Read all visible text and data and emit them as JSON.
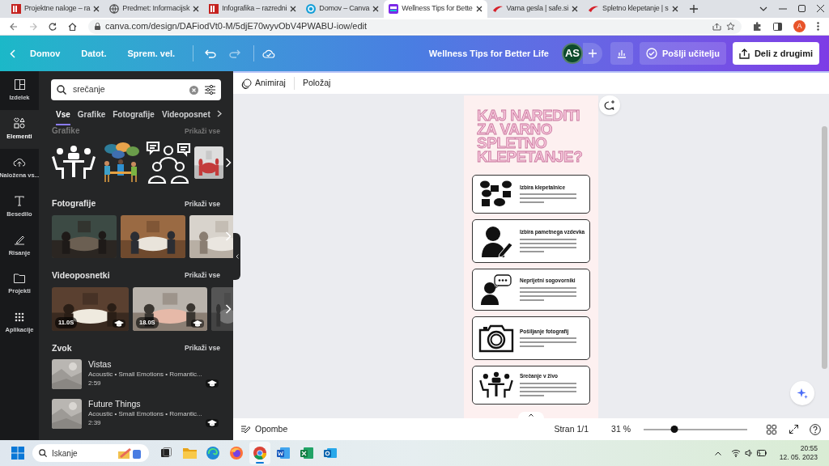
{
  "browser": {
    "tabs": [
      {
        "title": "Projektne naloge – ra",
        "kind": "slides",
        "selected": false
      },
      {
        "title": "Predmet: Informacijsk",
        "kind": "globe",
        "selected": false
      },
      {
        "title": "Infografika – razredni",
        "kind": "slides",
        "selected": false
      },
      {
        "title": "Domov – Canva",
        "kind": "canva",
        "selected": false
      },
      {
        "title": "Wellness Tips for Bette",
        "kind": "design",
        "selected": true
      },
      {
        "title": "Varna gesla | safe.si",
        "kind": "safe",
        "selected": false
      },
      {
        "title": "Spletno klepetanje | s",
        "kind": "safe",
        "selected": false
      }
    ],
    "url": "canva.com/design/DAFiodVt0-M/5djE70wyvObV4PWABU-iow/edit",
    "profile": "A"
  },
  "editor_bar": {
    "menu": [
      "Domov",
      "Datot.",
      "Sprem. vel."
    ],
    "design_title": "Wellness Tips for Better Life",
    "avatar": "AS",
    "send_button": "Pošlji učitelju",
    "share_button": "Deli z drugimi"
  },
  "rail": [
    {
      "label": "Izdelek",
      "kind": "layout",
      "selected": false
    },
    {
      "label": "Elementi",
      "kind": "shapes",
      "selected": true
    },
    {
      "label": "Naložena vs...",
      "kind": "upload",
      "selected": false
    },
    {
      "label": "Besedilo",
      "kind": "text",
      "selected": false
    },
    {
      "label": "Risanje",
      "kind": "draw",
      "selected": false
    },
    {
      "label": "Projekti",
      "kind": "folder",
      "selected": false
    },
    {
      "label": "Aplikacije",
      "kind": "apps",
      "selected": false
    }
  ],
  "panel": {
    "search": {
      "value": "srečanje"
    },
    "filters": [
      {
        "label": "Vse",
        "selected": true
      },
      {
        "label": "Grafike",
        "selected": false
      },
      {
        "label": "Fotografije",
        "selected": false
      },
      {
        "label": "Videoposnet",
        "selected": false
      }
    ],
    "graphics": {
      "title": "Grafike",
      "show_all": "Prikaži vse"
    },
    "photos": {
      "title": "Fotografije",
      "show_all": "Prikaži vse"
    },
    "videos": {
      "title": "Videoposnetki",
      "show_all": "Prikaži vse",
      "items": [
        {
          "duration": "11.0S"
        },
        {
          "duration": "18.0S"
        }
      ]
    },
    "audio": {
      "title": "Zvok",
      "show_all": "Prikaži vse",
      "tracks": [
        {
          "title": "Vistas",
          "meta": "Acoustic • Small Emotions • Romantic...",
          "duration": "2:59"
        },
        {
          "title": "Future Things",
          "meta": "Acoustic • Small Emotions • Romantic...",
          "duration": "2:39"
        }
      ]
    }
  },
  "toolbar": [
    "Animiraj",
    "Položaj"
  ],
  "design": {
    "title": [
      "KAJ NAREDITI",
      "ZA VARNO",
      "SPLETNO",
      "KLEPETANJE?"
    ],
    "cards": [
      {
        "heading": "Izbira klepetalnice",
        "kind": "chat"
      },
      {
        "heading": "Izbira pametnega vzdevka",
        "kind": "person-pen"
      },
      {
        "heading": "Neprijetni sogovorniki",
        "kind": "person-speech"
      },
      {
        "heading": "Pošiljanje fotografij",
        "kind": "camera"
      },
      {
        "heading": "Srečanje v živo",
        "kind": "meeting"
      }
    ]
  },
  "bottom_bar": {
    "notes": "Opombe",
    "page": "Stran 1/1",
    "zoom": "31 %",
    "zoom_slider": {
      "level": 0.3
    }
  },
  "taskbar": {
    "search": "Iskanje",
    "apps": [
      {
        "kind": "taskview",
        "selected": false
      },
      {
        "kind": "files",
        "selected": false
      },
      {
        "kind": "edge",
        "selected": false
      },
      {
        "kind": "firefox",
        "selected": false
      },
      {
        "kind": "chrome",
        "selected": true
      },
      {
        "kind": "word",
        "selected": false
      },
      {
        "kind": "excel",
        "selected": false
      },
      {
        "kind": "outlook",
        "selected": false
      }
    ],
    "time": "20:55",
    "date": "12. 05. 2023"
  }
}
